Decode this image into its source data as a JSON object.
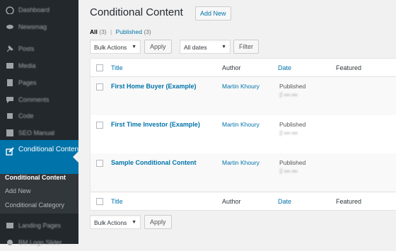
{
  "sidebar": {
    "items": [
      {
        "label": "Dashboard",
        "icon": "dashboard-icon"
      },
      {
        "label": "Newsmag",
        "icon": "newsmag-icon"
      },
      {
        "label": "Posts",
        "icon": "pin-icon"
      },
      {
        "label": "Media",
        "icon": "media-icon"
      },
      {
        "label": "Pages",
        "icon": "pages-icon"
      },
      {
        "label": "Comments",
        "icon": "comments-icon"
      },
      {
        "label": "Code",
        "icon": "code-icon"
      },
      {
        "label": "SEO Manual",
        "icon": "seo-icon"
      },
      {
        "label": "Landing Pages",
        "icon": "landing-icon"
      },
      {
        "label": "BM Logo Slider",
        "icon": "slider-icon"
      }
    ],
    "active": {
      "label": "Conditional Content",
      "icon": "edit-icon"
    },
    "submenu": [
      "Conditional Content",
      "Add New",
      "Conditional Category"
    ]
  },
  "header": {
    "title": "Conditional Content",
    "add_new": "Add New"
  },
  "views": {
    "all_label": "All",
    "all_count": "(3)",
    "separator": "|",
    "published_label": "Published",
    "published_count": "(3)"
  },
  "filters": {
    "bulk_actions": "Bulk Actions",
    "apply": "Apply",
    "dates": "All dates",
    "filter": "Filter"
  },
  "table": {
    "columns": [
      "Title",
      "Author",
      "Date",
      "Featured"
    ],
    "rows": [
      {
        "title": "First Home Buyer (Example)",
        "author": "Martin Khoury",
        "status": "Published",
        "date": "2 ••• •••"
      },
      {
        "title": "First Time Investor (Example)",
        "author": "Martin Khoury",
        "status": "Published",
        "date": "2 ••• •••"
      },
      {
        "title": "Sample Conditional Content",
        "author": "Martin Khoury",
        "status": "Published",
        "date": "2 ••• •••"
      }
    ]
  },
  "bottom_filters": {
    "bulk_actions": "Bulk Actions",
    "apply": "Apply"
  },
  "colors": {
    "sidebar": "#23282d",
    "accent": "#0073aa",
    "link": "#0073aa"
  }
}
